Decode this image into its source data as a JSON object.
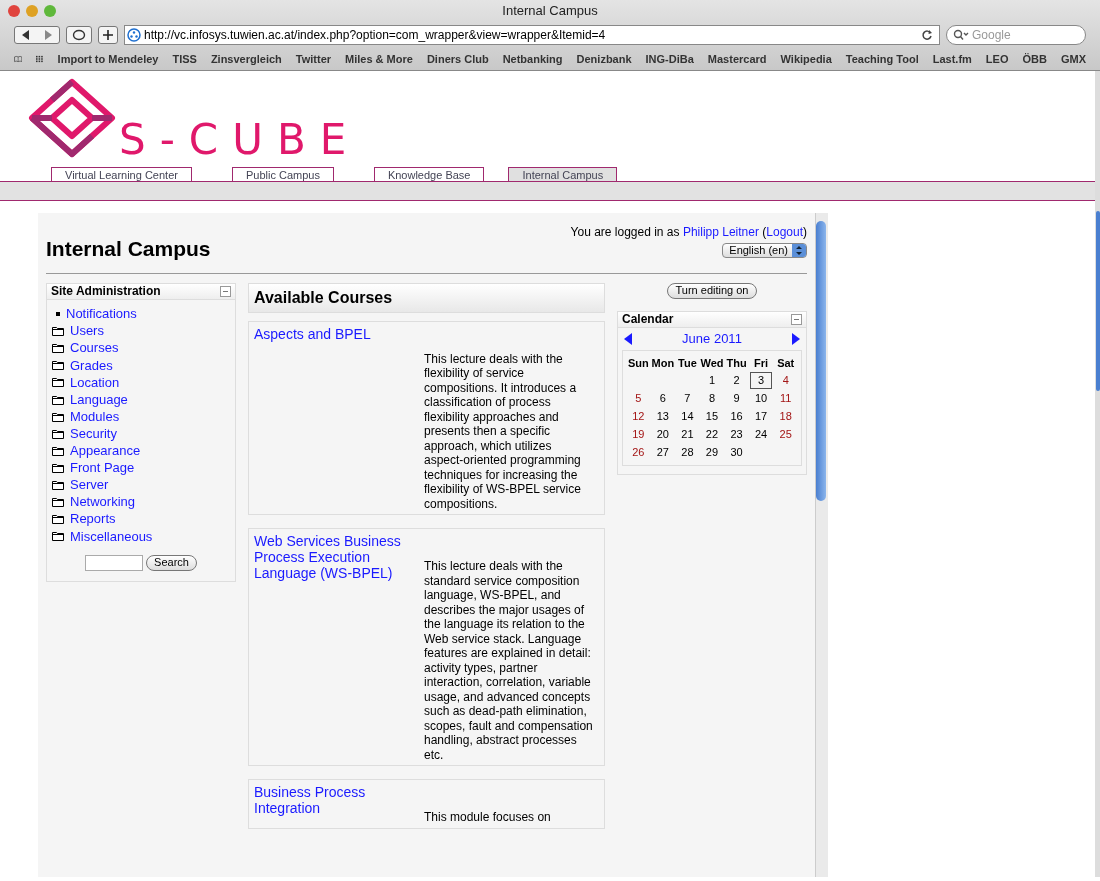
{
  "window": {
    "title": "Internal Campus"
  },
  "toolbar": {
    "url": "http://vc.infosys.tuwien.ac.at/index.php?option=com_wrapper&view=wrapper&Itemid=4",
    "search_placeholder": "Google"
  },
  "bookmarks": [
    "Import to Mendeley",
    "TISS",
    "Zinsvergleich",
    "Twitter",
    "Miles & More",
    "Diners Club",
    "Netbanking",
    "Denizbank",
    "ING-DiBa",
    "Mastercard",
    "Wikipedia",
    "Teaching Tool",
    "Last.fm",
    "LEO",
    "ÖBB",
    "GMX"
  ],
  "logo": {
    "text": "S-CUBE"
  },
  "site_tabs": [
    {
      "label": "Virtual Learning Center",
      "selected": false
    },
    {
      "label": "Public Campus",
      "selected": false
    },
    {
      "label": "Knowledge Base",
      "selected": false
    },
    {
      "label": "Internal Campus",
      "selected": true
    }
  ],
  "header": {
    "title": "Internal Campus",
    "login_prefix": "You are logged in as",
    "user": "Philipp Leitner",
    "logout_open": "(",
    "logout": "Logout",
    "logout_close": ")",
    "language": "English (en)"
  },
  "site_administration": {
    "title": "Site Administration",
    "items": [
      {
        "label": "Notifications",
        "kind": "bullet"
      },
      {
        "label": "Users",
        "kind": "folder"
      },
      {
        "label": "Courses",
        "kind": "folder"
      },
      {
        "label": "Grades",
        "kind": "folder"
      },
      {
        "label": "Location",
        "kind": "folder"
      },
      {
        "label": "Language",
        "kind": "folder"
      },
      {
        "label": "Modules",
        "kind": "folder"
      },
      {
        "label": "Security",
        "kind": "folder"
      },
      {
        "label": "Appearance",
        "kind": "folder"
      },
      {
        "label": "Front Page",
        "kind": "folder"
      },
      {
        "label": "Server",
        "kind": "folder"
      },
      {
        "label": "Networking",
        "kind": "folder"
      },
      {
        "label": "Reports",
        "kind": "folder"
      },
      {
        "label": "Miscellaneous",
        "kind": "folder"
      }
    ],
    "search_button": "Search"
  },
  "available_courses": {
    "title": "Available Courses",
    "courses": [
      {
        "title": "Aspects and BPEL",
        "description": "This lecture deals with the flexibility of service compositions. It introduces a classification of process flexibility approaches and presents then a specific approach, which utilizes aspect-oriented programming techniques for increasing the flexibility of WS-BPEL service compositions."
      },
      {
        "title": "Web Services Business Process Execution Language (WS-BPEL)",
        "description": "This lecture deals with the standard service composition language, WS-BPEL, and describes the major usages of the language its relation to the Web service stack. Language features are explained in detail: activity types, partner interaction, correlation, variable usage, and advanced concepts such as dead-path elimination, scopes, fault and compensation handling, abstract processes etc."
      },
      {
        "title": "Business Process Integration",
        "description": "This module focuses on"
      }
    ]
  },
  "editing_button": "Turn editing on",
  "calendar": {
    "title": "Calendar",
    "month": "June 2011",
    "weekdays": [
      "Sun",
      "Mon",
      "Tue",
      "Wed",
      "Thu",
      "Fri",
      "Sat"
    ],
    "weeks": [
      {
        "right_aligned": true,
        "days": [
          {
            "day": "1",
            "today": false
          },
          {
            "day": "2",
            "today": false
          },
          {
            "day": "3",
            "today": true
          },
          {
            "day": "4",
            "today": false
          }
        ]
      },
      {
        "days": [
          {
            "day": "5",
            "today": false
          },
          {
            "day": "6",
            "today": false
          },
          {
            "day": "7",
            "today": false
          },
          {
            "day": "8",
            "today": false
          },
          {
            "day": "9",
            "today": false
          },
          {
            "day": "10",
            "today": false
          },
          {
            "day": "11",
            "today": false
          }
        ]
      },
      {
        "days": [
          {
            "day": "12",
            "today": false
          },
          {
            "day": "13",
            "today": false
          },
          {
            "day": "14",
            "today": false
          },
          {
            "day": "15",
            "today": false
          },
          {
            "day": "16",
            "today": false
          },
          {
            "day": "17",
            "today": false
          },
          {
            "day": "18",
            "today": false
          }
        ]
      },
      {
        "days": [
          {
            "day": "19",
            "today": false
          },
          {
            "day": "20",
            "today": false
          },
          {
            "day": "21",
            "today": false
          },
          {
            "day": "22",
            "today": false
          },
          {
            "day": "23",
            "today": false
          },
          {
            "day": "24",
            "today": false
          },
          {
            "day": "25",
            "today": false
          }
        ]
      },
      {
        "days": [
          {
            "day": "26",
            "today": false
          },
          {
            "day": "27",
            "today": false
          },
          {
            "day": "28",
            "today": false
          },
          {
            "day": "29",
            "today": false
          },
          {
            "day": "30",
            "today": false
          }
        ]
      }
    ]
  }
}
